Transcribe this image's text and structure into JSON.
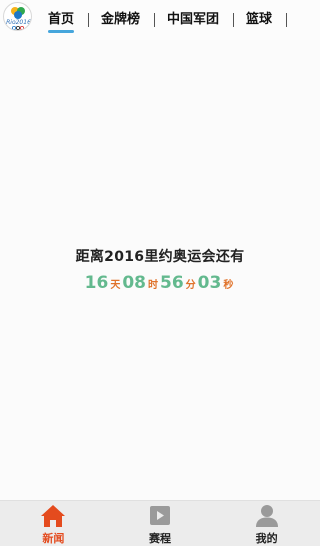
{
  "top_tabs": [
    {
      "label": "首页",
      "active": true
    },
    {
      "label": "金牌榜",
      "active": false
    },
    {
      "label": "中国军团",
      "active": false
    },
    {
      "label": "篮球",
      "active": false
    }
  ],
  "countdown": {
    "title": "距离2016里约奥运会还有",
    "days": "16",
    "days_unit": "天",
    "hours": "08",
    "hours_unit": "时",
    "minutes": "56",
    "minutes_unit": "分",
    "seconds": "03",
    "seconds_unit": "秒"
  },
  "bottom_nav": [
    {
      "label": "新闻",
      "icon": "home-icon",
      "active": true
    },
    {
      "label": "赛程",
      "icon": "play-icon",
      "active": false
    },
    {
      "label": "我的",
      "icon": "user-icon",
      "active": false
    }
  ],
  "colors": {
    "tab_indicator": "#46a6dc",
    "countdown_number": "#63b98e",
    "countdown_unit": "#e0722a",
    "nav_active": "#e44b1e",
    "nav_inactive_icon": "#9a9a9a"
  }
}
